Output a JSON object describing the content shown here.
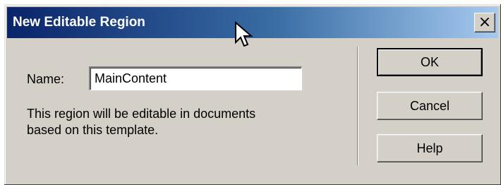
{
  "dialog": {
    "title": "New Editable Region",
    "close_glyph": "×",
    "name_label": "Name:",
    "name_value": "MainContent",
    "info_line1": "This region will be editable in documents",
    "info_line2": "based on this template."
  },
  "buttons": {
    "ok": "OK",
    "cancel": "Cancel",
    "help": "Help"
  },
  "icons": {
    "close": "close-icon",
    "cursor": "mouse-pointer-icon"
  },
  "colors": {
    "titlebar_start": "#0a246a",
    "titlebar_end": "#a6caf0",
    "dialog_bg": "#d4d0c8"
  }
}
